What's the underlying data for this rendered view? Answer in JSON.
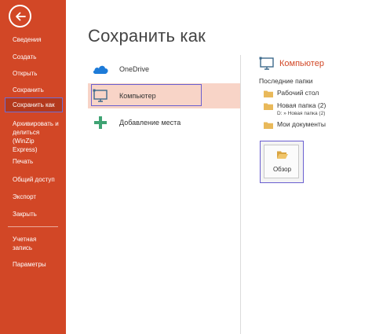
{
  "sidebar": {
    "back_label": "",
    "items": [
      {
        "label": "Сведения"
      },
      {
        "label": "Создать"
      },
      {
        "label": "Открыть"
      },
      {
        "label": "Сохранить"
      },
      {
        "label": "Сохранить как"
      },
      {
        "label": "Архивировать и делиться (WinZip Express)"
      },
      {
        "label": "Печать"
      },
      {
        "label": "Общий доступ"
      },
      {
        "label": "Экспорт"
      },
      {
        "label": "Закрыть"
      },
      {
        "label": "Учетная запись"
      },
      {
        "label": "Параметры"
      }
    ]
  },
  "main": {
    "title": "Сохранить как",
    "places": [
      {
        "label": "OneDrive",
        "icon": "cloud-icon"
      },
      {
        "label": "Компьютер",
        "icon": "computer-icon"
      },
      {
        "label": "Добавление места",
        "icon": "plus-icon"
      }
    ]
  },
  "right": {
    "title": "Компьютер",
    "recent_label": "Последние папки",
    "folders": [
      {
        "name": "Рабочий стол",
        "path": ""
      },
      {
        "name": "Новая папка (2)",
        "path": "D: » Новая папка (2)"
      },
      {
        "name": "Мои документы",
        "path": ""
      }
    ],
    "browse_label": "Обзор"
  },
  "colors": {
    "accent": "#d24726",
    "selected_bg": "#f8d4c7",
    "highlight_border": "#6a5fd0"
  }
}
